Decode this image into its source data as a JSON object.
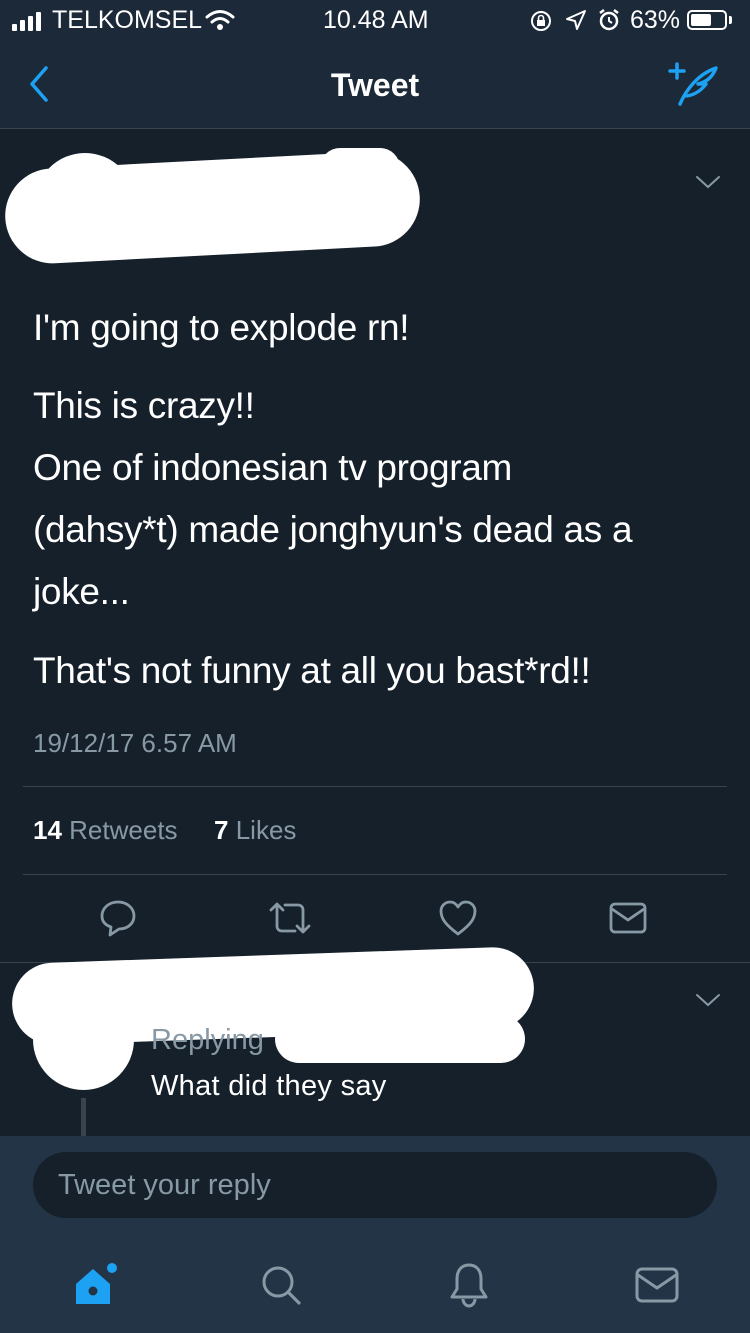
{
  "status_bar": {
    "carrier": "TELKOMSEL",
    "time": "10.48 AM",
    "battery_percent": "63%",
    "battery_level": 0.63
  },
  "nav": {
    "title": "Tweet",
    "back_icon": "chevron-left-icon",
    "compose_icon": "compose-tweet-icon"
  },
  "tweet": {
    "lines": [
      "I'm going to explode rn!",
      "This is crazy!!",
      "One of indonesian tv program",
      "(dahsy*t) made jonghyun's dead as a",
      "joke...",
      "That's not funny at all you bast*rd!!"
    ],
    "timestamp": "19/12/17 6.57 AM",
    "retweets_count": "14",
    "retweets_label": "Retweets",
    "likes_count": "7",
    "likes_label": "Likes",
    "actions": [
      "reply-icon",
      "retweet-icon",
      "like-icon",
      "message-icon"
    ]
  },
  "reply": {
    "replying_label": "Replying",
    "text": "What did they say"
  },
  "composer": {
    "placeholder": "Tweet your reply"
  },
  "tab_bar": {
    "tabs": [
      "home-icon",
      "search-icon",
      "notifications-icon",
      "messages-icon"
    ]
  },
  "colors": {
    "background": "#15202b",
    "bar": "#1c2938",
    "accent": "#1da1f2",
    "secondary_text": "#8899a6",
    "divider": "#38444d"
  }
}
